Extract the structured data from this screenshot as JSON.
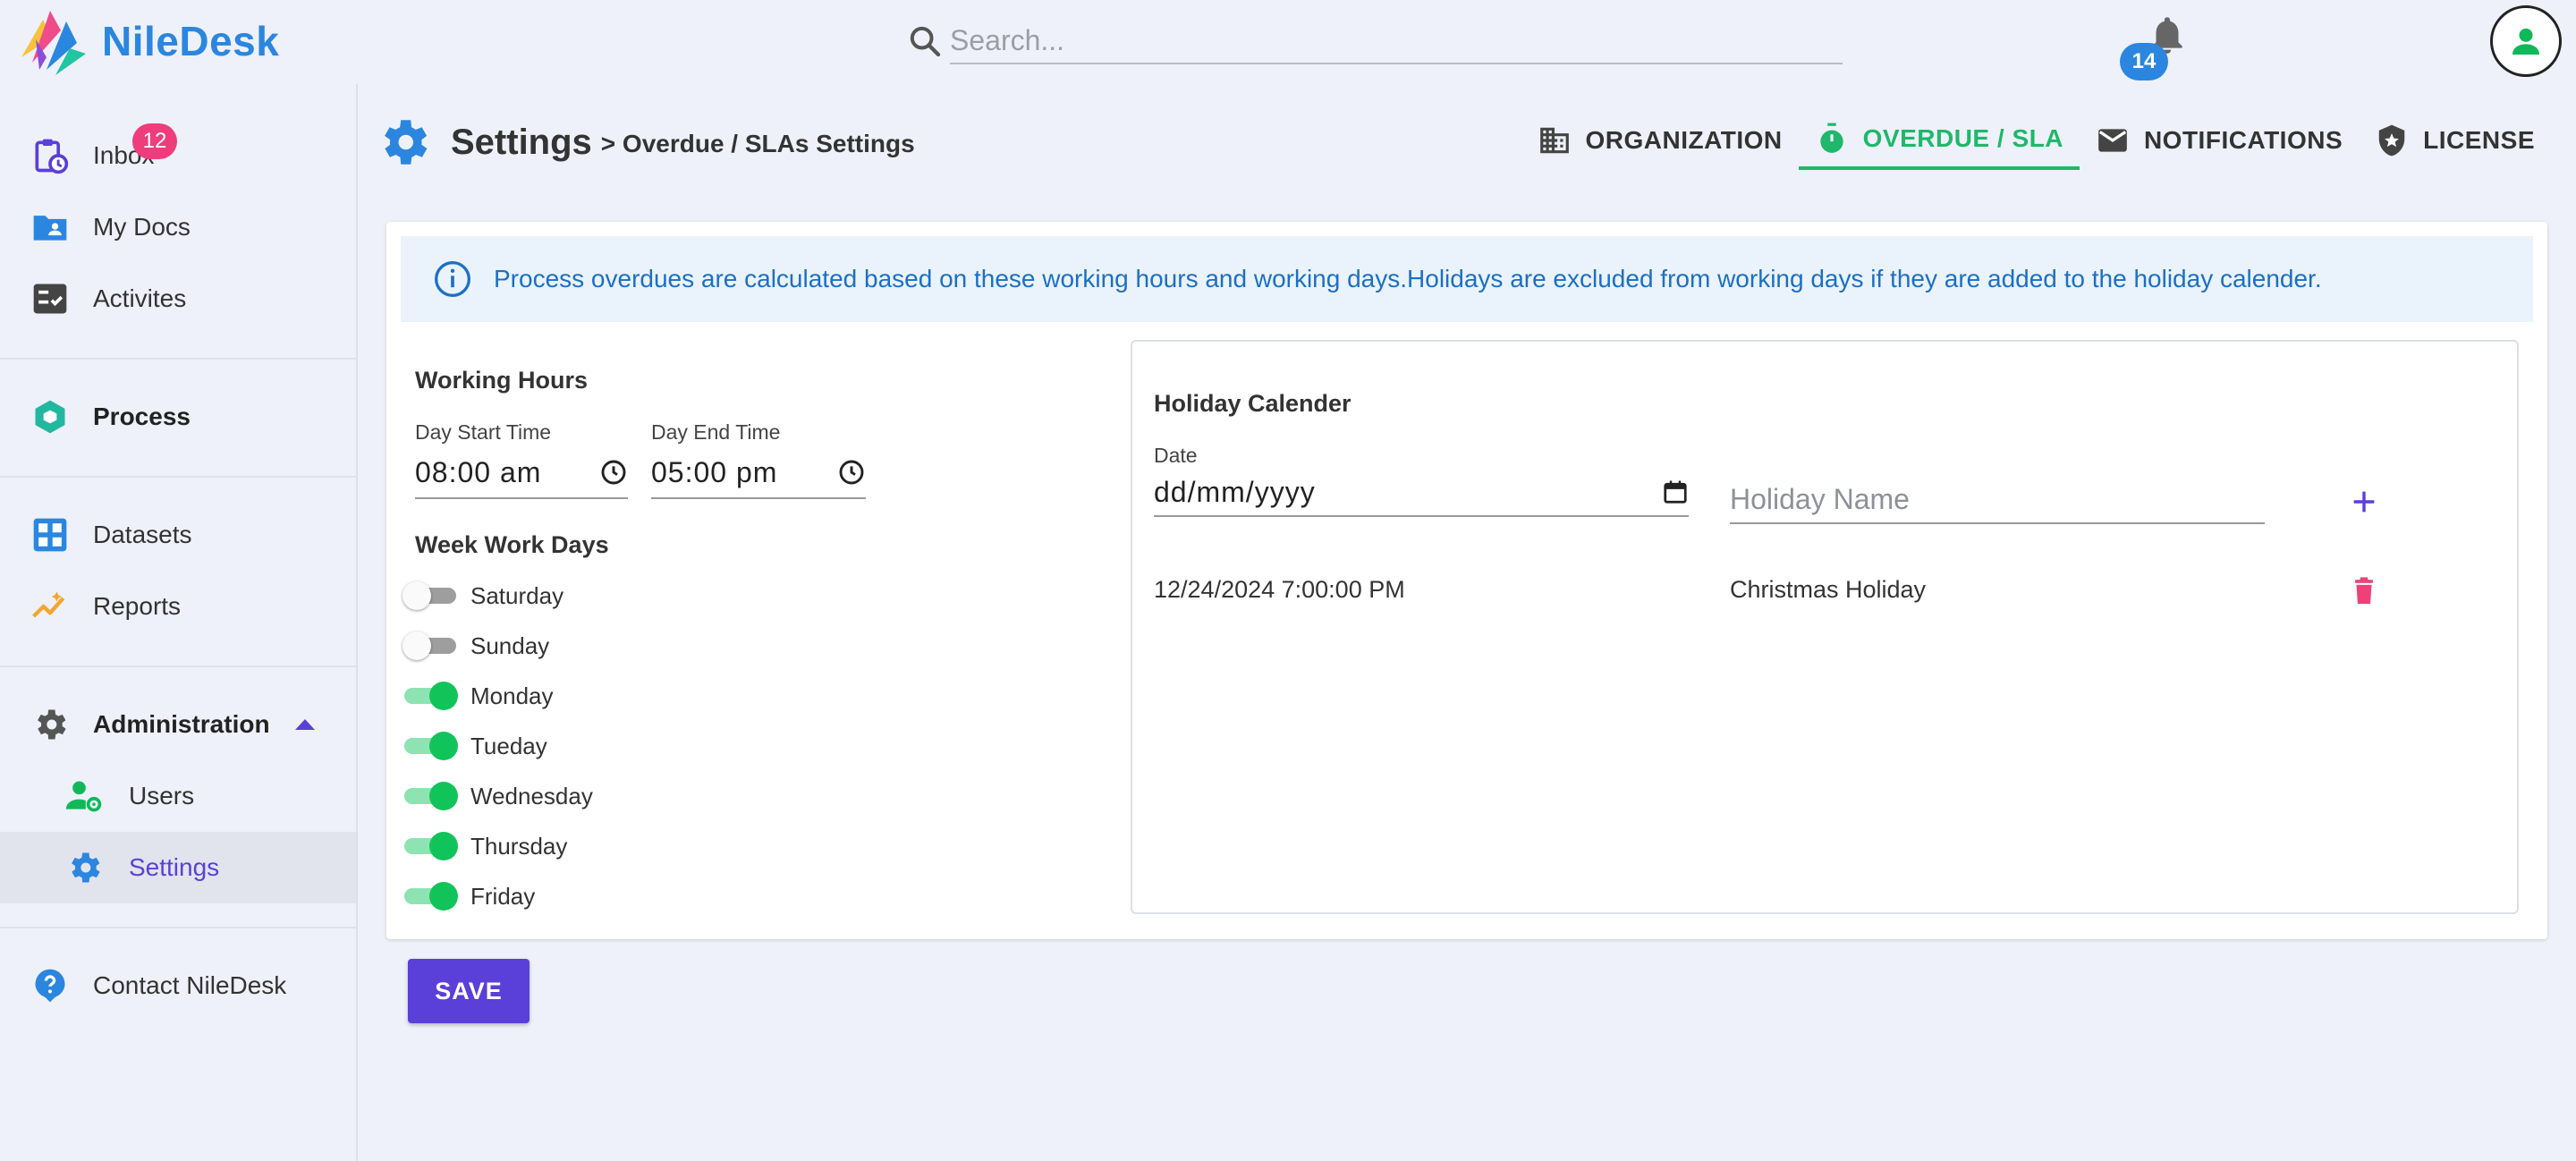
{
  "app": {
    "name": "NileDesk"
  },
  "search": {
    "placeholder": "Search..."
  },
  "notifications": {
    "count": "14"
  },
  "sidebar": {
    "inbox": {
      "label": "Inbox",
      "badge": "12"
    },
    "my_docs": "My Docs",
    "activities": "Activites",
    "process": "Process",
    "datasets": "Datasets",
    "reports": "Reports",
    "administration": "Administration",
    "users": "Users",
    "settings": "Settings",
    "contact": "Contact NileDesk"
  },
  "header": {
    "title": "Settings",
    "breadcrumb": "> Overdue / SLAs Settings",
    "tabs": [
      "ORGANIZATION",
      "OVERDUE / SLA",
      "NOTIFICATIONS",
      "LICENSE"
    ],
    "active_tab": "OVERDUE / SLA"
  },
  "info": {
    "text": "Process overdues are calculated based on these working hours and working days.Holidays are excluded from working days if they are added to the holiday calender."
  },
  "working_hours": {
    "title": "Working Hours",
    "start_label": "Day Start Time",
    "start_value": "08:00 am",
    "end_label": "Day End Time",
    "end_value": "05:00 pm"
  },
  "week_days": {
    "title": "Week Work Days",
    "days": [
      {
        "label": "Saturday",
        "enabled": false
      },
      {
        "label": "Sunday",
        "enabled": false
      },
      {
        "label": "Monday",
        "enabled": true
      },
      {
        "label": "Tueday",
        "enabled": true
      },
      {
        "label": "Wednesday",
        "enabled": true
      },
      {
        "label": "Thursday",
        "enabled": true
      },
      {
        "label": "Friday",
        "enabled": true
      }
    ]
  },
  "holiday": {
    "title": "Holiday Calender",
    "date_label": "Date",
    "date_placeholder": "dd/mm/yyyy",
    "name_placeholder": "Holiday Name",
    "rows": [
      {
        "date": "12/24/2024 7:00:00 PM",
        "name": "Christmas Holiday"
      }
    ]
  },
  "actions": {
    "save": "SAVE"
  },
  "colors": {
    "brand": "#2b86e0",
    "accent": "#5a3fd8",
    "active_tab": "#1fb86a",
    "badge": "#ee3d7a",
    "danger": "#f0407a"
  }
}
